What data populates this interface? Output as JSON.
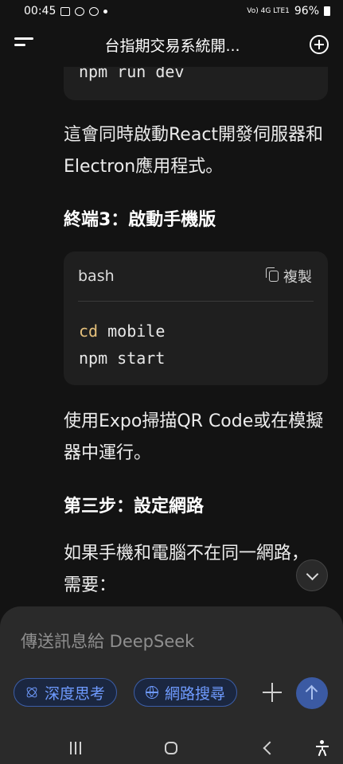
{
  "status_bar": {
    "time": "00:45",
    "network_text": "Vo) 4G LTE1",
    "battery": "96%"
  },
  "header": {
    "title": "台指期交易系統開..."
  },
  "conversation": {
    "top_code_line": "npm run dev",
    "para1": "這會同時啟動React開發伺服器和Electron應用程式。",
    "heading1": "終端3：啟動手機版",
    "code_block": {
      "language": "bash",
      "copy_label": "複製",
      "line1_cmd": "cd",
      "line1_arg": " mobile",
      "line2": "npm start"
    },
    "para2": "使用Expo掃描QR Code或在模擬器中運行。",
    "heading2": "第三步：設定網路",
    "para3": "如果手機和電腦不在同一網路，需要："
  },
  "composer": {
    "placeholder": "傳送訊息給 DeepSeek",
    "deep_think_label": "深度思考",
    "web_search_label": "網路搜尋"
  },
  "icons": {
    "menu": "menu-icon",
    "new_chat": "new-chat-icon",
    "copy": "copy-icon",
    "scroll_down": "chevron-down-icon",
    "deep_think": "atom-icon",
    "web_search": "globe-icon",
    "send": "arrow-up-icon"
  },
  "colors": {
    "accent": "#6f9bff",
    "background": "#131313",
    "composer_bg": "#2a2a2a",
    "keyword": "#e5c07b"
  }
}
